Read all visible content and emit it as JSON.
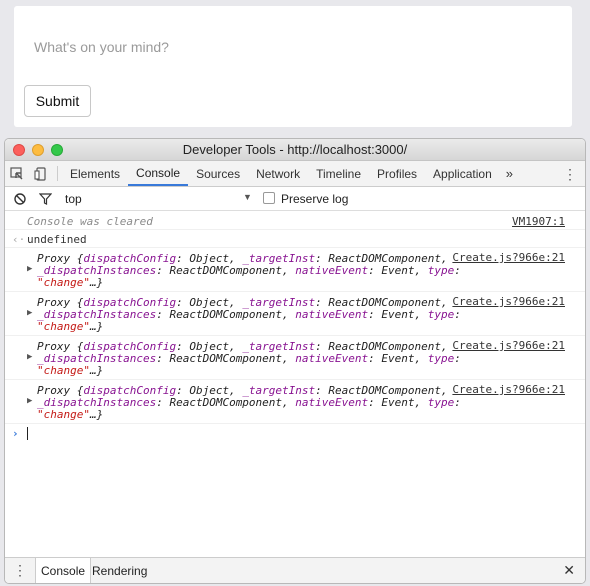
{
  "app": {
    "input_placeholder": "What's on your mind?",
    "submit_label": "Submit"
  },
  "devtools": {
    "window_title": "Developer Tools - http://localhost:3000/",
    "tabs": [
      "Elements",
      "Console",
      "Sources",
      "Network",
      "Timeline",
      "Profiles",
      "Application"
    ],
    "active_tab": "Console",
    "more_tabs": "»",
    "menu_glyph": "⋮",
    "filter": {
      "context": "top",
      "context_arrow": "▼",
      "preserve_log_label": "Preserve log",
      "preserve_log_checked": false
    },
    "console": {
      "cleared_message": "Console was cleared",
      "cleared_source": "VM1907:1",
      "result_arrow": "‹·",
      "result": "undefined",
      "events": [
        {
          "line1": "Proxy {dispatchConfig: Object, _targetInst: ReactDOMComponent,",
          "line2": "_dispatchInstances: ReactDOMComponent, nativeEvent: Event, type:",
          "line3": "\"change\"…}",
          "source": "Create.js?966e:21"
        },
        {
          "line1": "Proxy {dispatchConfig: Object, _targetInst: ReactDOMComponent,",
          "line2": "_dispatchInstances: ReactDOMComponent, nativeEvent: Event, type:",
          "line3": "\"change\"…}",
          "source": "Create.js?966e:21"
        },
        {
          "line1": "Proxy {dispatchConfig: Object, _targetInst: ReactDOMComponent,",
          "line2": "_dispatchInstances: ReactDOMComponent, nativeEvent: Event, type:",
          "line3": "\"change\"…}",
          "source": "Create.js?966e:21"
        },
        {
          "line1": "Proxy {dispatchConfig: Object, _targetInst: ReactDOMComponent,",
          "line2": "_dispatchInstances: ReactDOMComponent, nativeEvent: Event, type:",
          "line3": "\"change\"…}",
          "source": "Create.js?966e:21"
        }
      ],
      "prompt": "›"
    },
    "drawer": {
      "tabs": [
        "Console",
        "Rendering"
      ],
      "close": "✕"
    }
  },
  "colors": {
    "accent": "#3879d9",
    "property": "#881391",
    "string": "#c41a16"
  }
}
